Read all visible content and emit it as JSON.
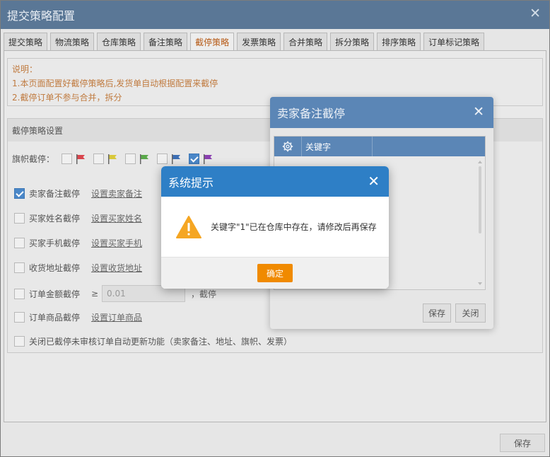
{
  "window": {
    "title": "提交策略配置",
    "close": "✕"
  },
  "tabs": [
    {
      "label": "提交策略",
      "active": false
    },
    {
      "label": "物流策略",
      "active": false
    },
    {
      "label": "仓库策略",
      "active": false
    },
    {
      "label": "备注策略",
      "active": false
    },
    {
      "label": "截停策略",
      "active": true
    },
    {
      "label": "发票策略",
      "active": false
    },
    {
      "label": "合并策略",
      "active": false
    },
    {
      "label": "拆分策略",
      "active": false
    },
    {
      "label": "排序策略",
      "active": false
    },
    {
      "label": "订单标记策略",
      "active": false
    }
  ],
  "notice": {
    "heading": "说明：",
    "line1": "1.本页面配置好截停策略后,发货单自动根据配置来截停",
    "line2": "2.截停订单不参与合并，拆分"
  },
  "settings": {
    "header": "截停策略设置",
    "flags_label": "旗帜截停：",
    "flags": [
      {
        "color": "#d9454d",
        "checked": false
      },
      {
        "color": "#d8c83a",
        "checked": false
      },
      {
        "color": "#5aa84a",
        "checked": false
      },
      {
        "color": "#3d6fb4",
        "checked": false
      },
      {
        "color": "#8a3fb0",
        "checked": true
      }
    ],
    "rules": {
      "seller_note": {
        "label": "卖家备注截停",
        "link": "设置卖家备注",
        "checked": true
      },
      "buyer_name": {
        "label": "买家姓名截停",
        "link": "设置买家姓名",
        "checked": false
      },
      "buyer_phone": {
        "label": "买家手机截停",
        "link": "设置买家手机",
        "checked": false
      },
      "address": {
        "label": "收货地址截停",
        "link": "设置收货地址",
        "checked": false
      },
      "amount": {
        "label": "订单金额截停",
        "ge": "≥",
        "placeholder": "0.01",
        "tail": "，截停",
        "checked": false
      },
      "product": {
        "label": "订单商品截停",
        "link": "设置订单商品",
        "checked": false
      },
      "close_auto": {
        "label": "关闭已截停未审核订单自动更新功能（卖家备注、地址、旗帜、发票）",
        "checked": false
      }
    }
  },
  "footer": {
    "save": "保存"
  },
  "seller_dialog": {
    "title": "卖家备注截停",
    "close": "✕",
    "column_keyword": "关键字",
    "save": "保存",
    "close_btn": "关闭"
  },
  "system_dialog": {
    "title": "系统提示",
    "close": "✕",
    "message": "关键字\"1\"已在仓库中存在，请修改后再保存",
    "ok": "确定"
  }
}
